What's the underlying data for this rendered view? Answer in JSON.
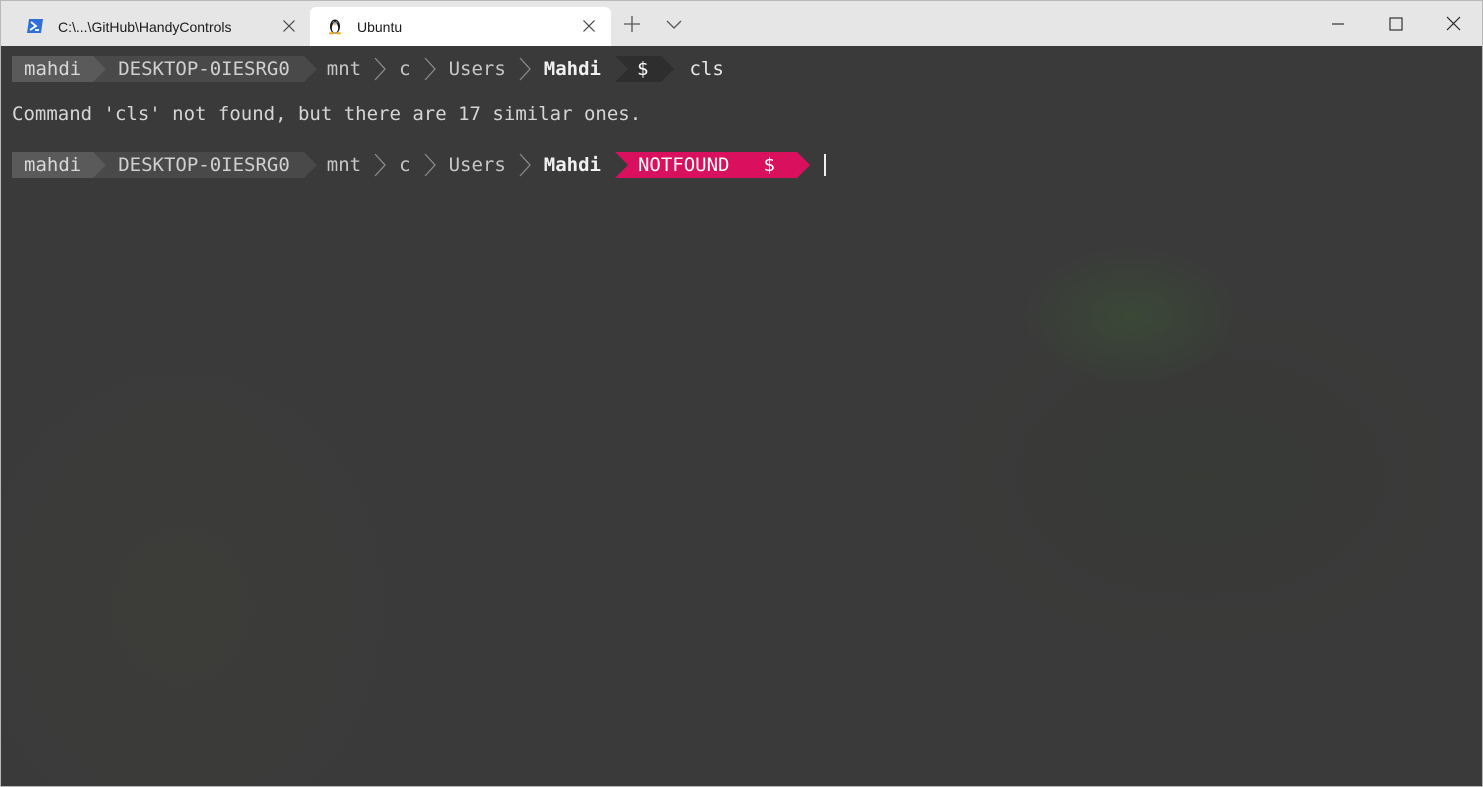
{
  "tabs": [
    {
      "label": "C:\\...\\GitHub\\HandyControls",
      "icon": "powershell-icon",
      "active": false
    },
    {
      "label": "Ubuntu",
      "icon": "linux-tux-icon",
      "active": true
    }
  ],
  "tabbar": {
    "new_tab_icon": "plus-icon",
    "dropdown_icon": "chevron-down-icon"
  },
  "window_controls": {
    "minimize_icon": "minimize-icon",
    "maximize_icon": "maximize-icon",
    "close_icon": "close-icon"
  },
  "terminal": {
    "prompt1": {
      "user": "mahdi",
      "host": "DESKTOP-0IESRG0",
      "path": [
        "mnt",
        "c",
        "Users"
      ],
      "cwd": "Mahdi",
      "symbol": "$",
      "command": "cls"
    },
    "output": "Command 'cls' not found, but there are 17 similar ones.",
    "prompt2": {
      "user": "mahdi",
      "host": "DESKTOP-0IESRG0",
      "path": [
        "mnt",
        "c",
        "Users"
      ],
      "cwd": "Mahdi",
      "status": "NOTFOUND",
      "symbol": "$"
    }
  },
  "colors": {
    "terminal_bg": "#3a3a3a",
    "error_segment": "#d9105d",
    "tabbar_bg": "#e6e6e6"
  }
}
